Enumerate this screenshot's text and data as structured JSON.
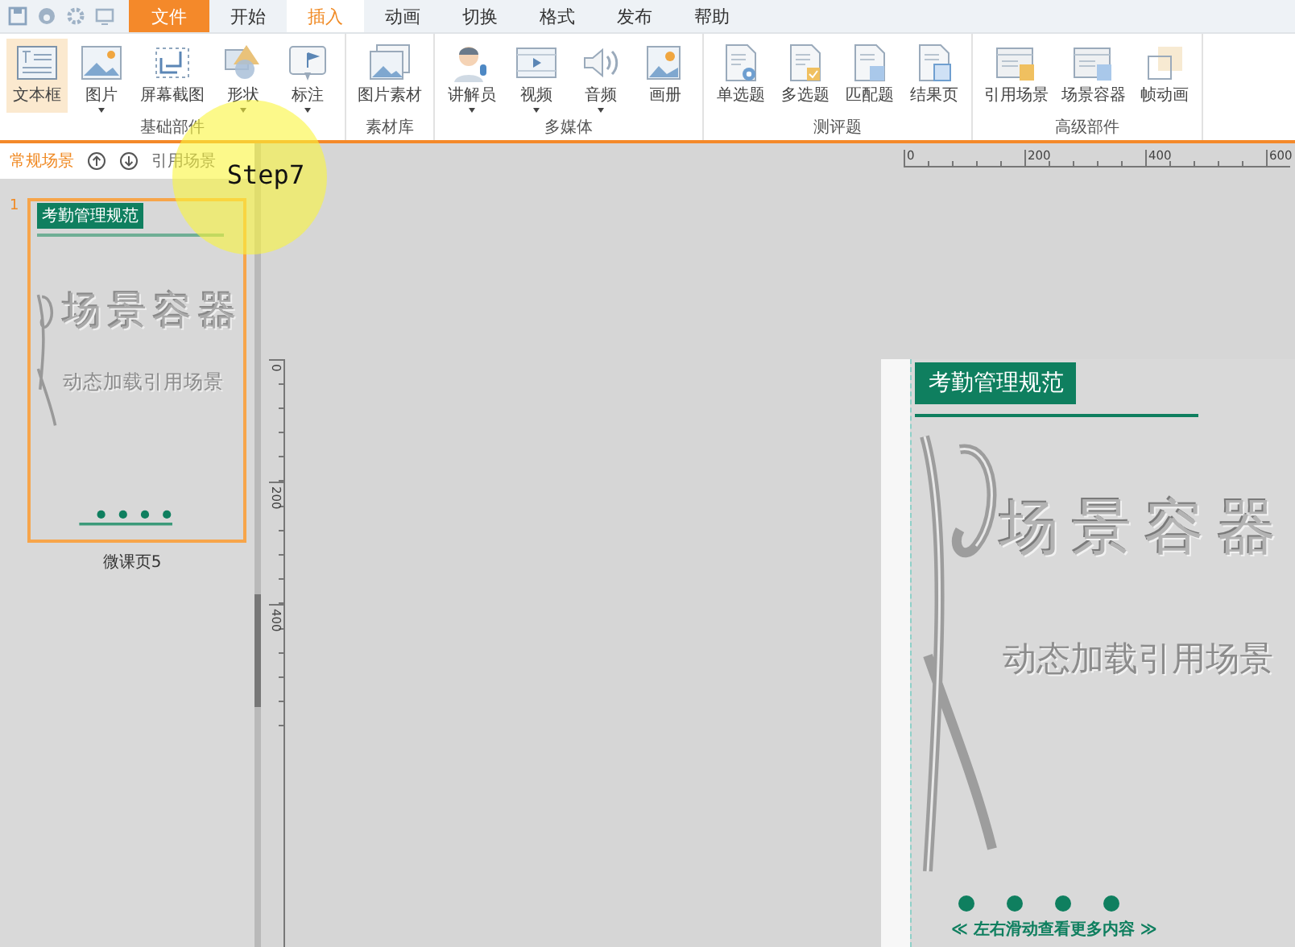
{
  "menu_tabs": [
    {
      "label": "文件",
      "kind": "file",
      "selected": false
    },
    {
      "label": "开始",
      "kind": "tab",
      "selected": false
    },
    {
      "label": "插入",
      "kind": "tab",
      "selected": true
    },
    {
      "label": "动画",
      "kind": "tab",
      "selected": false
    },
    {
      "label": "切换",
      "kind": "tab",
      "selected": false
    },
    {
      "label": "格式",
      "kind": "tab",
      "selected": false
    },
    {
      "label": "发布",
      "kind": "tab",
      "selected": false
    },
    {
      "label": "帮助",
      "kind": "tab",
      "selected": false
    }
  ],
  "ribbon_groups": [
    {
      "label": "基础部件",
      "buttons": [
        {
          "label": "文本框",
          "selected": true,
          "dropdown": false
        },
        {
          "label": "图片",
          "selected": false,
          "dropdown": true
        },
        {
          "label": "屏幕截图",
          "selected": false,
          "dropdown": false
        },
        {
          "label": "形状",
          "selected": false,
          "dropdown": true
        },
        {
          "label": "标注",
          "selected": false,
          "dropdown": true
        }
      ]
    },
    {
      "label": "素材库",
      "buttons": [
        {
          "label": "图片素材",
          "selected": false,
          "dropdown": false
        }
      ]
    },
    {
      "label": "多媒体",
      "buttons": [
        {
          "label": "讲解员",
          "selected": false,
          "dropdown": true
        },
        {
          "label": "视频",
          "selected": false,
          "dropdown": true
        },
        {
          "label": "音频",
          "selected": false,
          "dropdown": true
        },
        {
          "label": "画册",
          "selected": false,
          "dropdown": false
        }
      ]
    },
    {
      "label": "测评题",
      "buttons": [
        {
          "label": "单选题",
          "selected": false,
          "dropdown": false
        },
        {
          "label": "多选题",
          "selected": false,
          "dropdown": false
        },
        {
          "label": "匹配题",
          "selected": false,
          "dropdown": false
        },
        {
          "label": "结果页",
          "selected": false,
          "dropdown": false
        }
      ]
    },
    {
      "label": "高级部件",
      "buttons": [
        {
          "label": "引用场景",
          "selected": false,
          "dropdown": false
        },
        {
          "label": "场景容器",
          "selected": false,
          "dropdown": false
        },
        {
          "label": "帧动画",
          "selected": false,
          "dropdown": false
        }
      ]
    }
  ],
  "scene_panel": {
    "tabs": [
      {
        "label": "常规场景",
        "selected": true
      },
      {
        "label": "引用场景",
        "selected": false
      }
    ],
    "thumbnails": [
      {
        "number": "1",
        "title": "考勤管理规范",
        "heading": "场景容器",
        "subheading": "动态加载引用场景",
        "caption": "微课页5",
        "selected": true
      }
    ]
  },
  "annotation": {
    "label": "Step7"
  },
  "rulers": {
    "horizontal": [
      "0",
      "200",
      "400",
      "600"
    ],
    "vertical": [
      "0",
      "200",
      "400"
    ]
  },
  "slide": {
    "title": "考勤管理规范",
    "heading": "场景容器",
    "subheading": "动态加载引用场景",
    "hint": "≪ 左右滑动查看更多内容 ≫"
  }
}
